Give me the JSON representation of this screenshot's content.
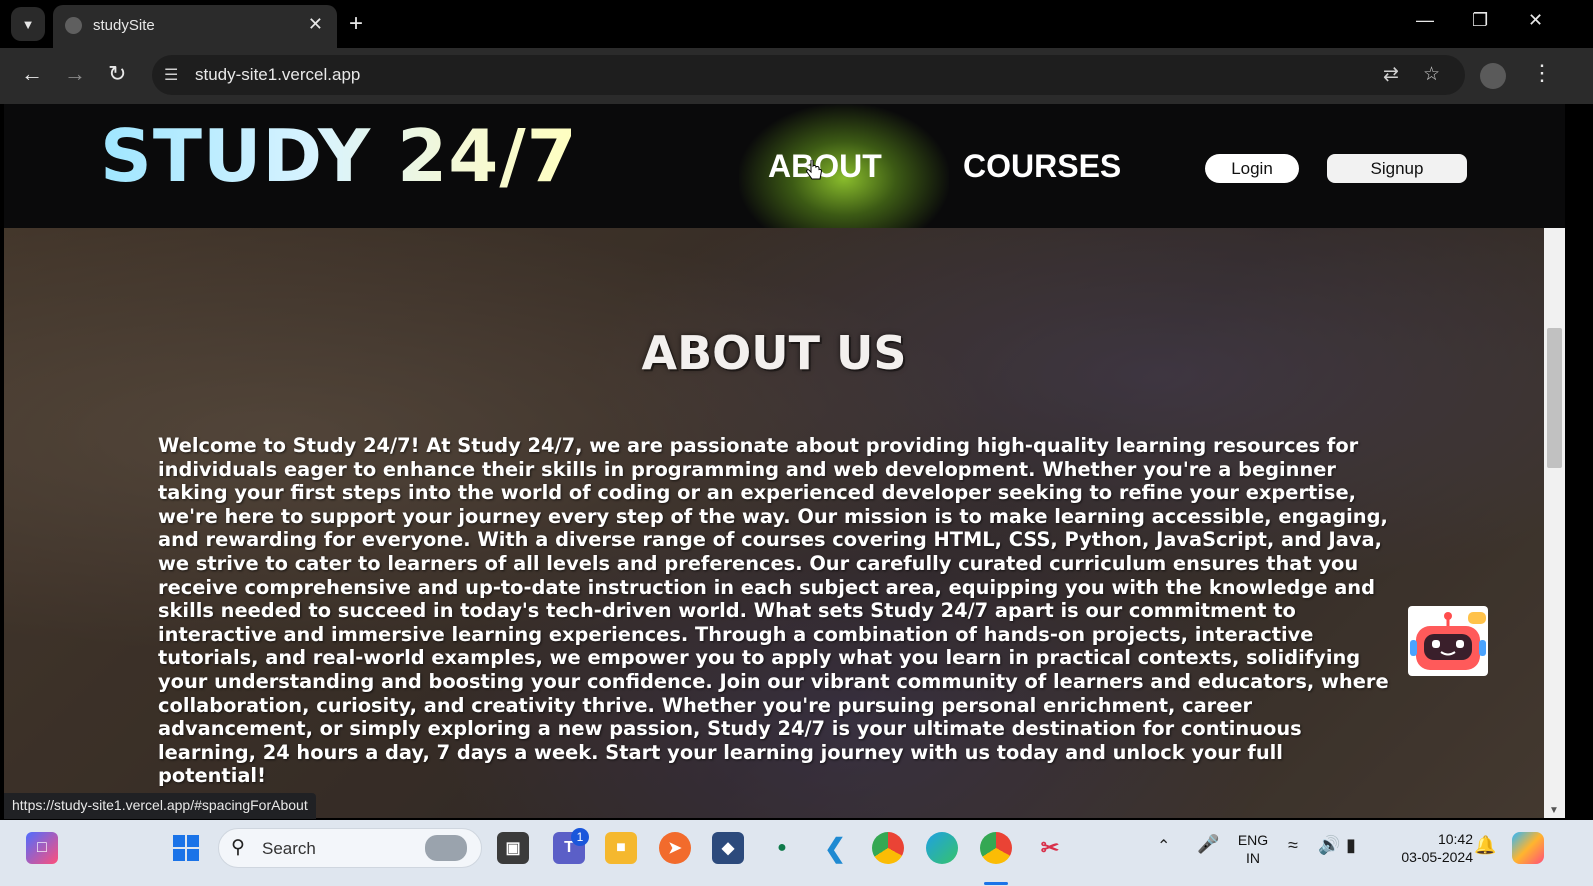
{
  "browser": {
    "tab_title": "studySite",
    "url": "study-site1.vercel.app",
    "status_url": "https://study-site1.vercel.app/#spacingForAbout"
  },
  "site": {
    "logo": "STUDY 24/7",
    "nav": {
      "about": "ABOUT",
      "courses": "COURSES"
    },
    "buttons": {
      "login": "Login",
      "signup": "Signup"
    },
    "about_title": "ABOUT US",
    "about_text": "Welcome to Study 24/7! At Study 24/7, we are passionate about providing high-quality learning resources for individuals eager to enhance their skills in programming and web development. Whether you're a beginner taking your first steps into the world of coding or an experienced developer seeking to refine your expertise, we're here to support your journey every step of the way. Our mission is to make learning accessible, engaging, and rewarding for everyone. With a diverse range of courses covering HTML, CSS, Python, JavaScript, and Java, we strive to cater to learners of all levels and preferences. Our carefully curated curriculum ensures that you receive comprehensive and up-to-date instruction in each subject area, equipping you with the knowledge and skills needed to succeed in today's tech-driven world. What sets Study 24/7 apart is our commitment to interactive and immersive learning experiences. Through a combination of hands-on projects, interactive tutorials, and real-world examples, we empower you to apply what you learn in practical contexts, solidifying your understanding and boosting your confidence. Join our vibrant community of learners and educators, where collaboration, curiosity, and creativity thrive. Whether you're pursuing personal enrichment, career advancement, or simply exploring a new passion, Study 24/7 is your ultimate destination for continuous learning, 24 hours a day, 7 days a week. Start your learning journey with us today and unlock your full potential!"
  },
  "taskbar": {
    "search_placeholder": "Search",
    "teams_badge": "1",
    "lang_primary": "ENG",
    "lang_secondary": "IN",
    "time": "10:42",
    "date": "03-05-2024"
  },
  "colors": {
    "nav_glow": "#a0dc32",
    "logo_gradient_start": "#9fe6ff",
    "logo_gradient_end": "#ffffc0",
    "header_bg": "#0a0a0b"
  }
}
